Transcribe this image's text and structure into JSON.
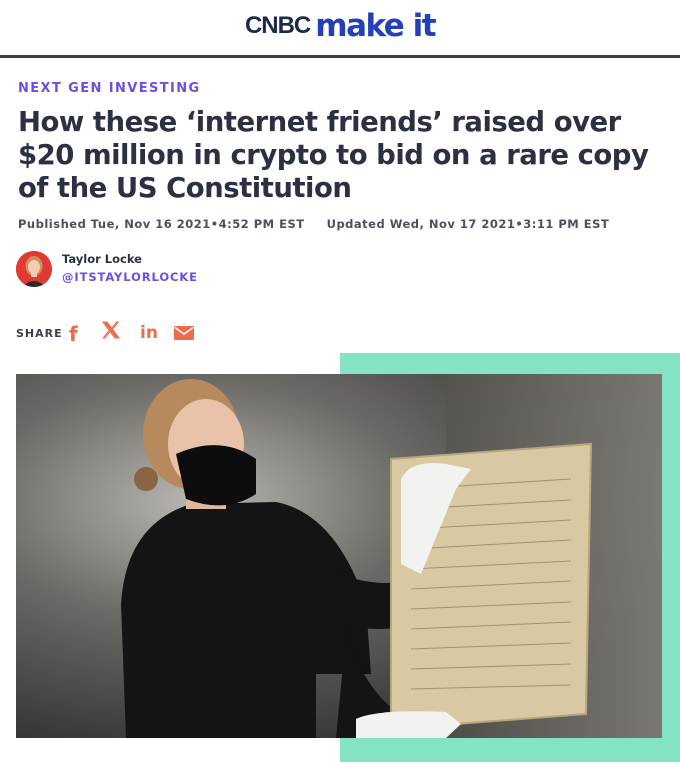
{
  "site": {
    "brand_cnbc": "CNBC",
    "brand_makeit": "make it"
  },
  "article": {
    "kicker": "NEXT GEN INVESTING",
    "headline": "How these ‘internet friends’ raised over $20 million in crypto to bid on a rare copy of the US Constitution",
    "published": "Published Tue, Nov 16 2021•4:52 PM EST",
    "updated": "Updated Wed, Nov 17 2021•3:11 PM EST"
  },
  "author": {
    "name": "Taylor Locke",
    "handle": "@ITSTAYLORLOCKE"
  },
  "share": {
    "label": "SHARE",
    "icons": [
      "facebook-icon",
      "x-icon",
      "linkedin-icon",
      "email-icon"
    ]
  },
  "colors": {
    "brand_navy": "#1b2a4a",
    "brand_blue": "#2340b8",
    "kicker_purple": "#6b4fe0",
    "share_orange": "#ee6a4d",
    "accent_mint": "#84e3c4"
  }
}
